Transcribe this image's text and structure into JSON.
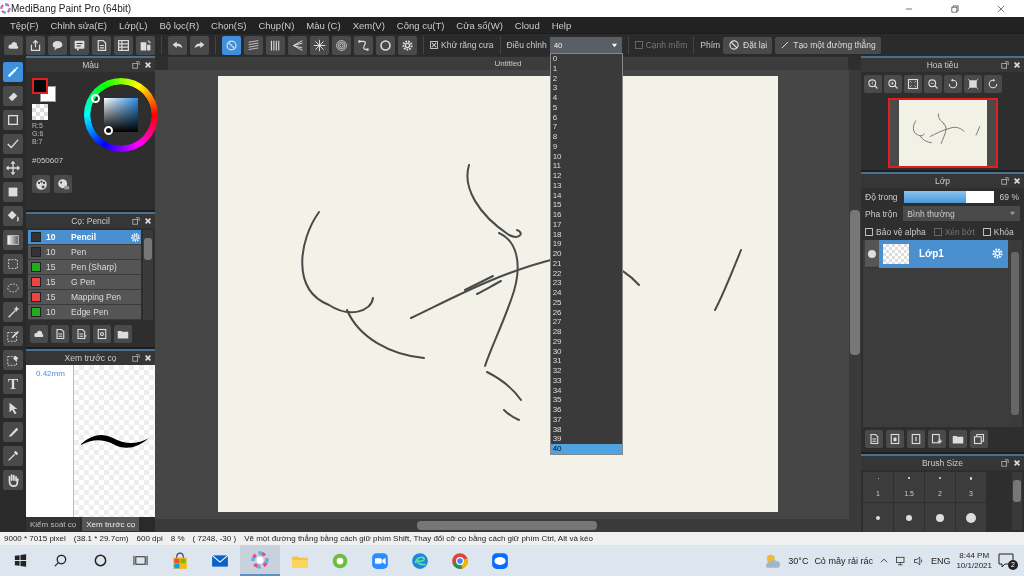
{
  "window": {
    "title": "MediBang Paint Pro (64bit)"
  },
  "menu": [
    "Tệp(F)",
    "Chỉnh sửa(E)",
    "Lớp(L)",
    "Bộ lọc(R)",
    "Chọn(S)",
    "Chụp(N)",
    "Màu (C)",
    "Xem(V)",
    "Công cụ(T)",
    "Cửa sổ(W)",
    "Cloud",
    "Help"
  ],
  "toolbar": {
    "file_buttons": [
      {
        "kind": "cloud"
      },
      {
        "kind": "share"
      },
      {
        "kind": "comment"
      },
      {
        "kind": "note"
      },
      {
        "kind": "page"
      },
      {
        "kind": "list"
      },
      {
        "kind": "grid"
      }
    ],
    "history_buttons": [
      {
        "kind": "undo"
      },
      {
        "kind": "redo"
      }
    ],
    "snaps": [
      {
        "kind": "off",
        "selected": true
      },
      {
        "kind": "parallel",
        "selected": false
      },
      {
        "kind": "cross",
        "selected": false
      },
      {
        "kind": "vanish",
        "selected": false
      },
      {
        "kind": "radial",
        "selected": false
      },
      {
        "kind": "concentric",
        "selected": false
      },
      {
        "kind": "curve",
        "selected": false
      },
      {
        "kind": "ellipse",
        "selected": false
      },
      {
        "kind": "settings",
        "selected": false
      }
    ],
    "antialias": {
      "label": "Khử răng cưa",
      "checked": true
    },
    "adjust": {
      "label": "Điều chỉnh",
      "value": "40",
      "options": [
        {
          "label": "0",
          "selected": false
        },
        {
          "label": "1",
          "selected": false
        },
        {
          "label": "2",
          "selected": false
        },
        {
          "label": "3",
          "selected": false
        },
        {
          "label": "4",
          "selected": false
        },
        {
          "label": "5",
          "selected": false
        },
        {
          "label": "6",
          "selected": false
        },
        {
          "label": "7",
          "selected": false
        },
        {
          "label": "8",
          "selected": false
        },
        {
          "label": "9",
          "selected": false
        },
        {
          "label": "10",
          "selected": false
        },
        {
          "label": "11",
          "selected": false
        },
        {
          "label": "12",
          "selected": false
        },
        {
          "label": "13",
          "selected": false
        },
        {
          "label": "14",
          "selected": false
        },
        {
          "label": "15",
          "selected": false
        },
        {
          "label": "16",
          "selected": false
        },
        {
          "label": "17",
          "selected": false
        },
        {
          "label": "18",
          "selected": false
        },
        {
          "label": "19",
          "selected": false
        },
        {
          "label": "20",
          "selected": false
        },
        {
          "label": "21",
          "selected": false
        },
        {
          "label": "22",
          "selected": false
        },
        {
          "label": "23",
          "selected": false
        },
        {
          "label": "24",
          "selected": false
        },
        {
          "label": "25",
          "selected": false
        },
        {
          "label": "26",
          "selected": false
        },
        {
          "label": "27",
          "selected": false
        },
        {
          "label": "28",
          "selected": false
        },
        {
          "label": "29",
          "selected": false
        },
        {
          "label": "30",
          "selected": false
        },
        {
          "label": "31",
          "selected": false
        },
        {
          "label": "32",
          "selected": false
        },
        {
          "label": "33",
          "selected": false
        },
        {
          "label": "34",
          "selected": false
        },
        {
          "label": "35",
          "selected": false
        },
        {
          "label": "36",
          "selected": false
        },
        {
          "label": "37",
          "selected": false
        },
        {
          "label": "38",
          "selected": false
        },
        {
          "label": "39",
          "selected": false
        },
        {
          "label": "40",
          "selected": true
        }
      ]
    },
    "soft_edge": {
      "label": "Cạnh mềm",
      "checked": false,
      "disabled": true
    },
    "keys_label": "Phím",
    "reset_button": "Đặt lại",
    "line_button": "Tạo một đường thẳng"
  },
  "tools": [
    {
      "kind": "brush",
      "selected": true
    },
    {
      "kind": "eraser",
      "selected": false
    },
    {
      "kind": "rect-outline",
      "selected": false
    },
    {
      "kind": "polyline",
      "selected": false
    },
    {
      "kind": "move",
      "selected": false
    },
    {
      "kind": "fill-rect",
      "selected": false
    },
    {
      "kind": "bucket",
      "selected": false
    },
    {
      "kind": "gradient",
      "selected": false
    },
    {
      "kind": "select-rect",
      "selected": false
    },
    {
      "kind": "lasso",
      "selected": false
    },
    {
      "kind": "wand",
      "selected": false
    },
    {
      "kind": "select-pen",
      "selected": false
    },
    {
      "kind": "select-eraser",
      "selected": false
    },
    {
      "kind": "text",
      "label": "T",
      "selected": false
    },
    {
      "kind": "operation",
      "selected": false
    },
    {
      "kind": "knife",
      "selected": false
    },
    {
      "kind": "eyedropper",
      "selected": false
    },
    {
      "kind": "hand",
      "selected": false
    }
  ],
  "color_panel": {
    "title": "Màu",
    "r": "R:5",
    "g": "G:6",
    "b": "B:7",
    "hex": "#050607"
  },
  "brush_panel": {
    "title": "Cọ: Pencil",
    "brushes": [
      {
        "size": "10",
        "name": "Pencil",
        "color": "#333333",
        "selected": true
      },
      {
        "size": "10",
        "name": "Pen",
        "color": "#333333",
        "selected": false
      },
      {
        "size": "15",
        "name": "Pen (Sharp)",
        "color": "#22aa22",
        "selected": false
      },
      {
        "size": "15",
        "name": "G Pen",
        "color": "#ee4444",
        "selected": false
      },
      {
        "size": "15",
        "name": "Mapping Pen",
        "color": "#ee4444",
        "selected": false
      },
      {
        "size": "10",
        "name": "Edge Pen",
        "color": "#22aa22",
        "selected": false
      }
    ]
  },
  "preview_panel": {
    "title": "Xem trước cọ",
    "size": "0.42mm",
    "tabs": [
      {
        "label": "Kiểm soát cọ",
        "selected": false
      },
      {
        "label": "Xem trước cọ",
        "selected": true
      }
    ]
  },
  "canvas": {
    "tab": "Untitled"
  },
  "navigator": {
    "title": "Hoa tiêu"
  },
  "layer_panel": {
    "title": "Lớp",
    "opacity_label": "Độ trong",
    "opacity": {
      "level": 0.69
    },
    "opacity_reading": "69 %",
    "blend_label": "Pha trộn",
    "blend": "Bình thường",
    "options": [
      {
        "label": "Bảo vệ alpha",
        "checked": false,
        "disabled": false
      },
      {
        "label": "Xén bớt",
        "checked": false,
        "disabled": true
      },
      {
        "label": "Khóa",
        "checked": false,
        "disabled": false
      }
    ],
    "layers": [
      {
        "name": "Lớp1",
        "visible": true,
        "selected": true
      }
    ]
  },
  "brush_size_panel": {
    "title": "Brush Size",
    "sizes": [
      "1",
      "1.5",
      "2",
      "3"
    ]
  },
  "status_bar": [
    "9000 * 7015 pixel",
    "(38.1 * 29.7cm)",
    "600 dpi",
    "8 %",
    "( 7248, -30 )",
    "Vẽ một đường thẳng bằng cách giữ phím Shift, Thay đổi cỡ cọ bằng cách giữ phím Ctrl, Alt và kéo"
  ],
  "taskbar": {
    "apps": [
      {
        "kind": "store",
        "selected": false
      },
      {
        "kind": "mail",
        "selected": false
      },
      {
        "kind": "medibang",
        "selected": true
      },
      {
        "kind": "explorer",
        "selected": false
      },
      {
        "kind": "green",
        "selected": false
      },
      {
        "kind": "zoom",
        "selected": false
      },
      {
        "kind": "edge",
        "selected": false
      },
      {
        "kind": "chrome",
        "selected": false
      },
      {
        "kind": "zalo",
        "selected": false
      }
    ],
    "temperature": "30°C",
    "weather": "Cỏ mây rải rác",
    "language": "ENG",
    "time": "8:44 PM",
    "date": "10/1/2021",
    "notifications": "2"
  }
}
